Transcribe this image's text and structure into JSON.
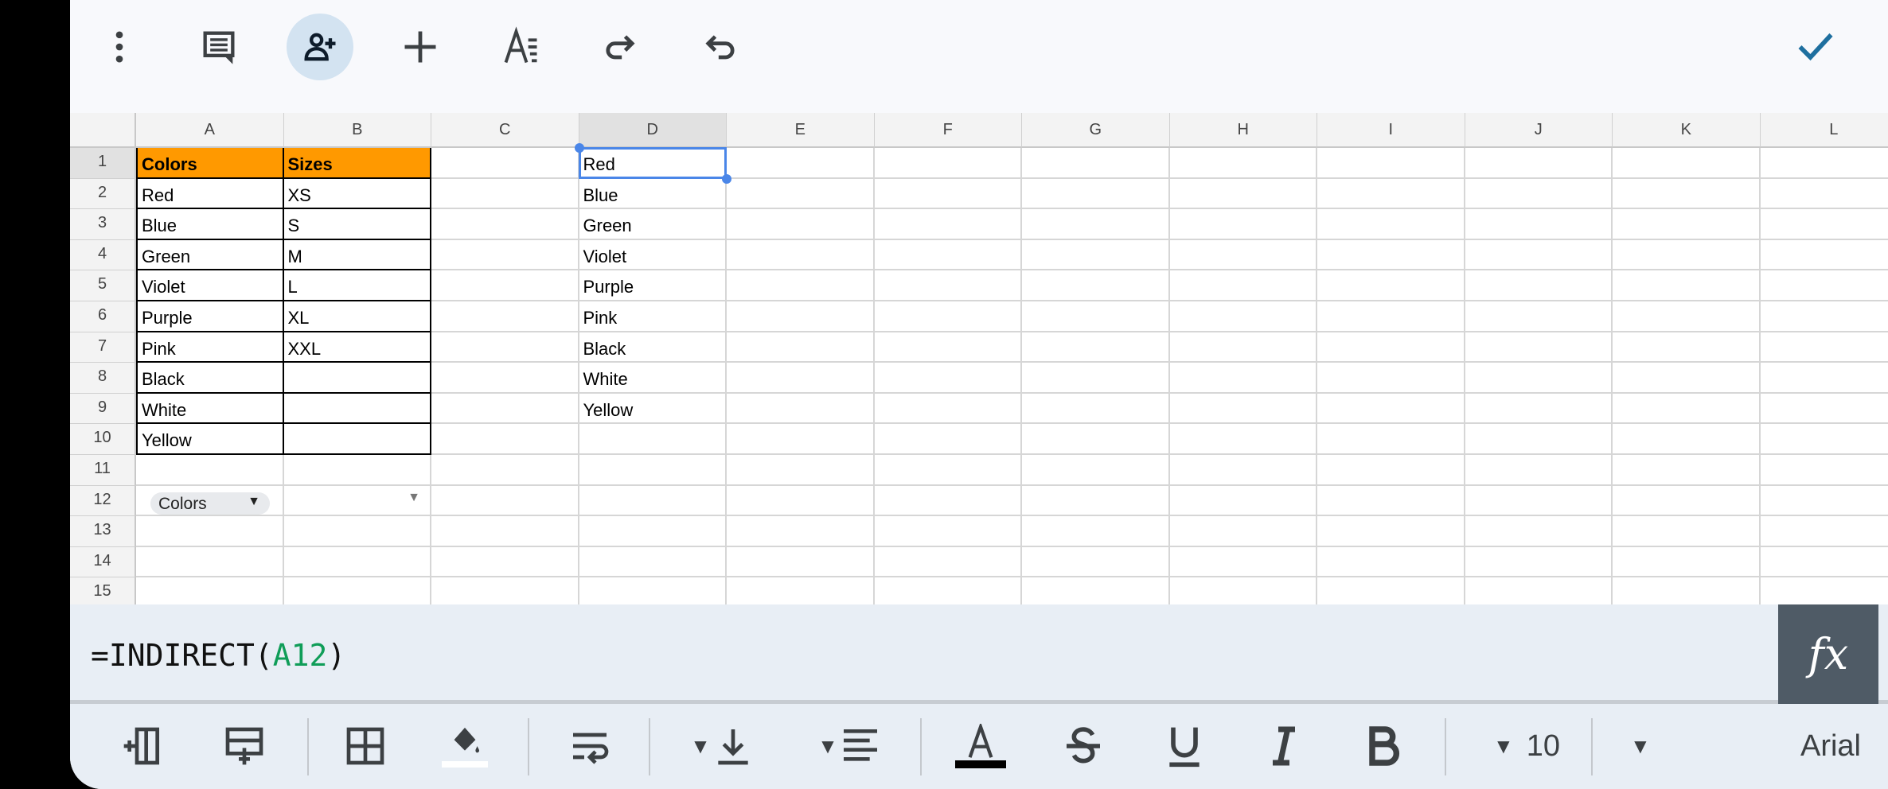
{
  "toolbar": {
    "items": [
      {
        "name": "more-options",
        "icon": "more-vert-icon"
      },
      {
        "name": "comment",
        "icon": "comment-icon"
      },
      {
        "name": "share-add-person",
        "icon": "person-add-icon",
        "active": true
      },
      {
        "name": "insert",
        "icon": "plus-icon"
      },
      {
        "name": "text-format",
        "icon": "text-format-icon"
      },
      {
        "name": "redo",
        "icon": "redo-icon"
      },
      {
        "name": "undo",
        "icon": "undo-icon"
      }
    ],
    "done_icon": "check-icon",
    "accent": "#1a73e8"
  },
  "grid": {
    "columns": [
      "A",
      "B",
      "C",
      "D",
      "E",
      "F",
      "G",
      "H",
      "I",
      "J",
      "K",
      "L"
    ],
    "selected_column": "D",
    "rows": [
      "1",
      "2",
      "3",
      "4",
      "5",
      "6",
      "7",
      "8",
      "9",
      "10",
      "11",
      "12",
      "13",
      "14",
      "15"
    ],
    "selected_row": "1",
    "selected_cell": "D1",
    "header_fill": "#ff9900",
    "cells": {
      "A1": "Colors",
      "B1": "Sizes",
      "A2": "Red",
      "B2": "XS",
      "A3": "Blue",
      "B3": "S",
      "A4": "Green",
      "B4": "M",
      "A5": "Violet",
      "B5": "L",
      "A6": "Purple",
      "B6": "XL",
      "A7": "Pink",
      "B7": "XXL",
      "A8": "Black",
      "A9": "White",
      "A10": "Yellow",
      "D1": "Red",
      "D2": "Blue",
      "D3": "Green",
      "D4": "Violet",
      "D5": "Purple",
      "D6": "Pink",
      "D7": "Black",
      "D8": "White",
      "D9": "Yellow"
    },
    "dropdown_A12": "Colors",
    "dropdown_B12": ""
  },
  "formula_bar": {
    "prefix": "=INDIRECT(",
    "reference": "A12",
    "suffix": ")",
    "fx_label": "fx"
  },
  "bottom_toolbar": {
    "font_size": "10",
    "font_name": "Arial",
    "text_color": "#000000",
    "fill_color": "#ffffff"
  }
}
